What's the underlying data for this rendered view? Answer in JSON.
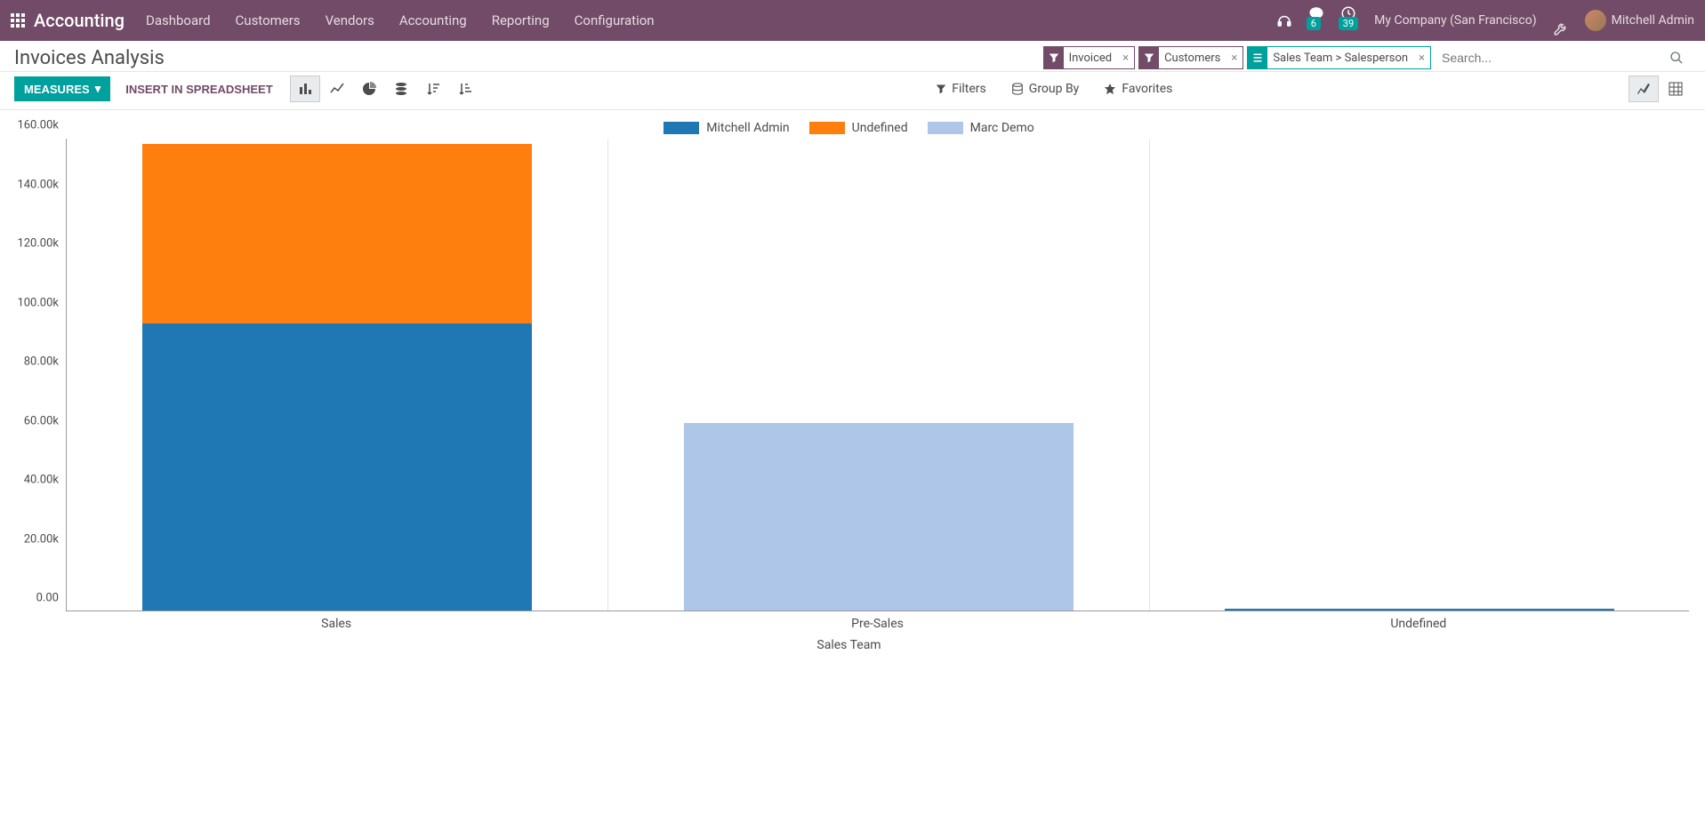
{
  "nav": {
    "brand": "Accounting",
    "menu": [
      "Dashboard",
      "Customers",
      "Vendors",
      "Accounting",
      "Reporting",
      "Configuration"
    ],
    "messages_badge": "6",
    "activities_badge": "39",
    "company": "My Company (San Francisco)",
    "user": "Mitchell Admin"
  },
  "header": {
    "title": "Invoices Analysis",
    "search_placeholder": "Search...",
    "facets": [
      {
        "type": "filter",
        "label": "Invoiced"
      },
      {
        "type": "filter",
        "label": "Customers"
      },
      {
        "type": "group",
        "label": "Sales Team > Salesperson"
      }
    ]
  },
  "cp": {
    "measures": "MEASURES",
    "insert": "INSERT IN SPREADSHEET",
    "filters": "Filters",
    "groupby": "Group By",
    "favorites": "Favorites"
  },
  "chart_data": {
    "type": "bar",
    "stacked": true,
    "xlabel": "Sales Team",
    "ylabel": "",
    "ylim": [
      0,
      160000
    ],
    "yticks": [
      "0.00",
      "20.00k",
      "40.00k",
      "60.00k",
      "80.00k",
      "100.00k",
      "120.00k",
      "140.00k",
      "160.00k"
    ],
    "categories": [
      "Sales",
      "Pre-Sales",
      "Undefined"
    ],
    "series": [
      {
        "name": "Mitchell Admin",
        "color": "#1f77b4",
        "values": [
          97000,
          0,
          500
        ]
      },
      {
        "name": "Undefined",
        "color": "#ff7f0e",
        "values": [
          61000,
          0,
          0
        ]
      },
      {
        "name": "Marc Demo",
        "color": "#aec7e8",
        "values": [
          0,
          63500,
          0
        ]
      }
    ]
  }
}
